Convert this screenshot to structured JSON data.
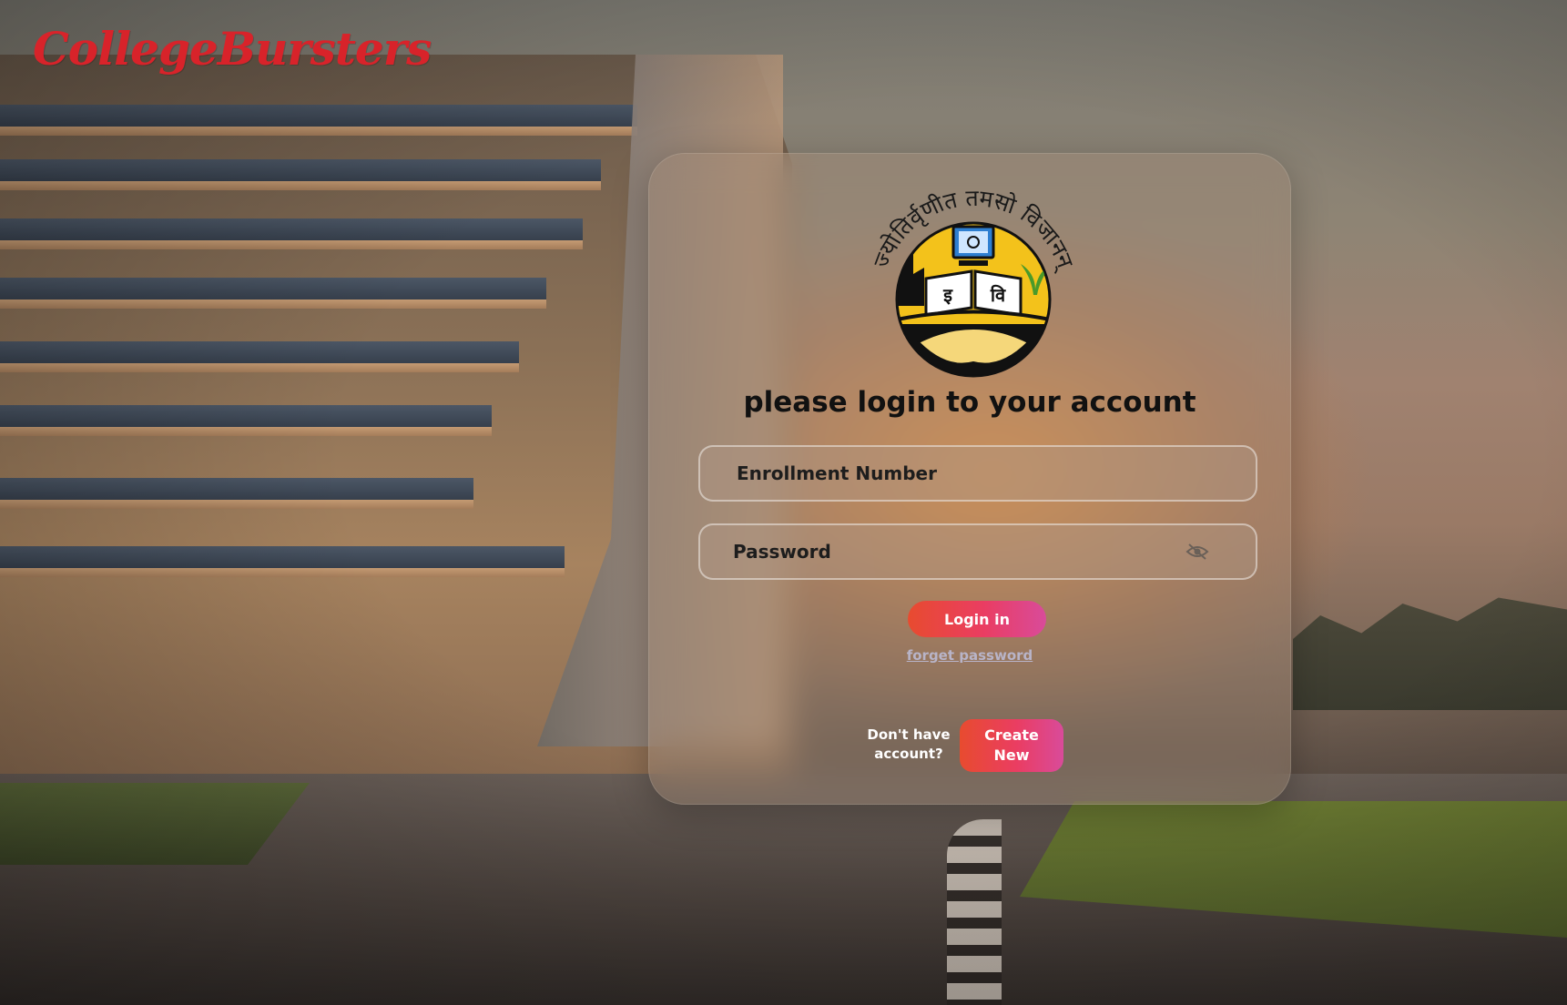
{
  "brand": {
    "name": "CollegeBursters",
    "color": "#d8232a"
  },
  "emblem": {
    "motto": "ज्योतिर्वृणीत तमसो विजानन्",
    "book_left": "इ",
    "book_right": "वि"
  },
  "login": {
    "title": "please login to your account",
    "enrollment": {
      "placeholder": "Enrollment Number",
      "value": ""
    },
    "password": {
      "placeholder": "Password",
      "value": "",
      "toggle_icon": "eye-off-icon"
    },
    "submit_label": "Login in",
    "forgot_label": "forget password",
    "no_account_text": "Don't have account?",
    "create_label": "Create New"
  },
  "colors": {
    "accent_start": "#e84b2f",
    "accent_mid": "#ea3d62",
    "accent_end": "#d94b9a",
    "link": "#b8b4c8"
  }
}
